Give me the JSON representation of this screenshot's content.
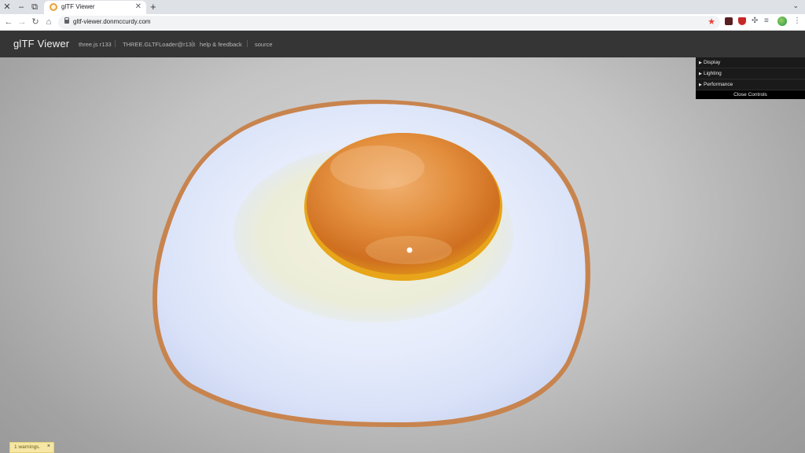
{
  "browser": {
    "tab_title": "glTF Viewer",
    "url": "gltf-viewer.donmccurdy.com",
    "icons": [
      "close-icon",
      "minimize-icon",
      "tab-search-icon",
      "new-tab-icon",
      "back-icon",
      "forward-icon",
      "reload-icon",
      "home-icon",
      "lock-icon",
      "star-icon",
      "extensions-icon",
      "menu-icon"
    ]
  },
  "header": {
    "title": "glTF Viewer",
    "links": [
      "three.js r133",
      "THREE.GLTFLoader@r133",
      "help & feedback",
      "source"
    ]
  },
  "controls": {
    "folders": [
      "Display",
      "Lighting",
      "Performance"
    ],
    "close_label": "Close Controls"
  },
  "toast": {
    "text": "1 warnings.",
    "close": "×"
  },
  "colors": {
    "header_bg": "#353535",
    "panel_bg": "#1a1a1a",
    "yolk": "#e08a2e",
    "egg_white": "#e9eefb",
    "toast_bg": "#f6e7a6"
  }
}
